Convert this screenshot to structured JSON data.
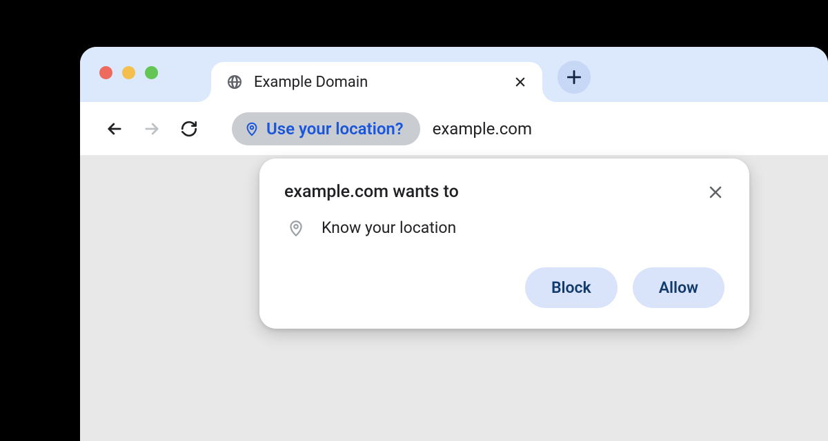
{
  "window": {
    "tab": {
      "title": "Example Domain",
      "favicon": "globe-icon"
    }
  },
  "toolbar": {
    "permission_chip": "Use your location?",
    "url": "example.com"
  },
  "dialog": {
    "title": "example.com wants to",
    "permission_label": "Know your location",
    "permission_icon": "location-pin-icon",
    "actions": {
      "block": "Block",
      "allow": "Allow"
    }
  },
  "colors": {
    "accent_bg": "#dce8fb",
    "chip_bg": "#c9cdd2",
    "link_blue": "#1a56db",
    "button_bg": "#d9e4fb",
    "button_text": "#123a6b"
  }
}
